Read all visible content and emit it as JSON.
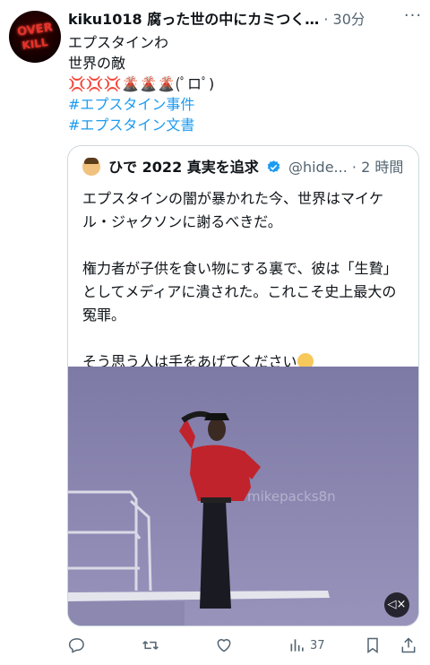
{
  "post": {
    "author": "kiku1018 腐った世の中にカミつく…",
    "separator": "·",
    "time": "30分",
    "avatar_text_1": "OVER",
    "avatar_text_2": "KILL",
    "lines": [
      "エプスタインわ",
      "世界の敵"
    ],
    "emoji_line_red": "💢💢💢",
    "emoji_line_volcano": "🌋🌋🌋",
    "emoji_line_face": "(ﾟロﾟ)",
    "hashtags": [
      "#エプスタイン事件",
      "#エプスタイン文書"
    ]
  },
  "quote": {
    "name": "ひで 2022 真実を追求",
    "handle": "@hide...",
    "separator": "·",
    "time": "2 時間",
    "paragraph1": "エプスタインの闇が暴かれた今、世界はマイケル・ジャクソンに謝るべきだ。",
    "paragraph2": "権力者が子供を食い物にする裏で、彼は「生贄」としてメディアに潰された。これこそ史上最大の冤罪。",
    "paragraph3": "そう思う人は手をあげてください",
    "video_watermark": "mikepacks8n"
  },
  "actions": {
    "views_count": "37"
  },
  "colors": {
    "accent": "#1d9bf0",
    "muted": "#536471",
    "border": "#cfd9de"
  },
  "icons": [
    "more-icon",
    "verified-badge-icon",
    "raising-hand-emoji",
    "mute-icon",
    "reply-icon",
    "retweet-icon",
    "like-icon",
    "views-icon",
    "bookmark-icon",
    "share-icon"
  ]
}
